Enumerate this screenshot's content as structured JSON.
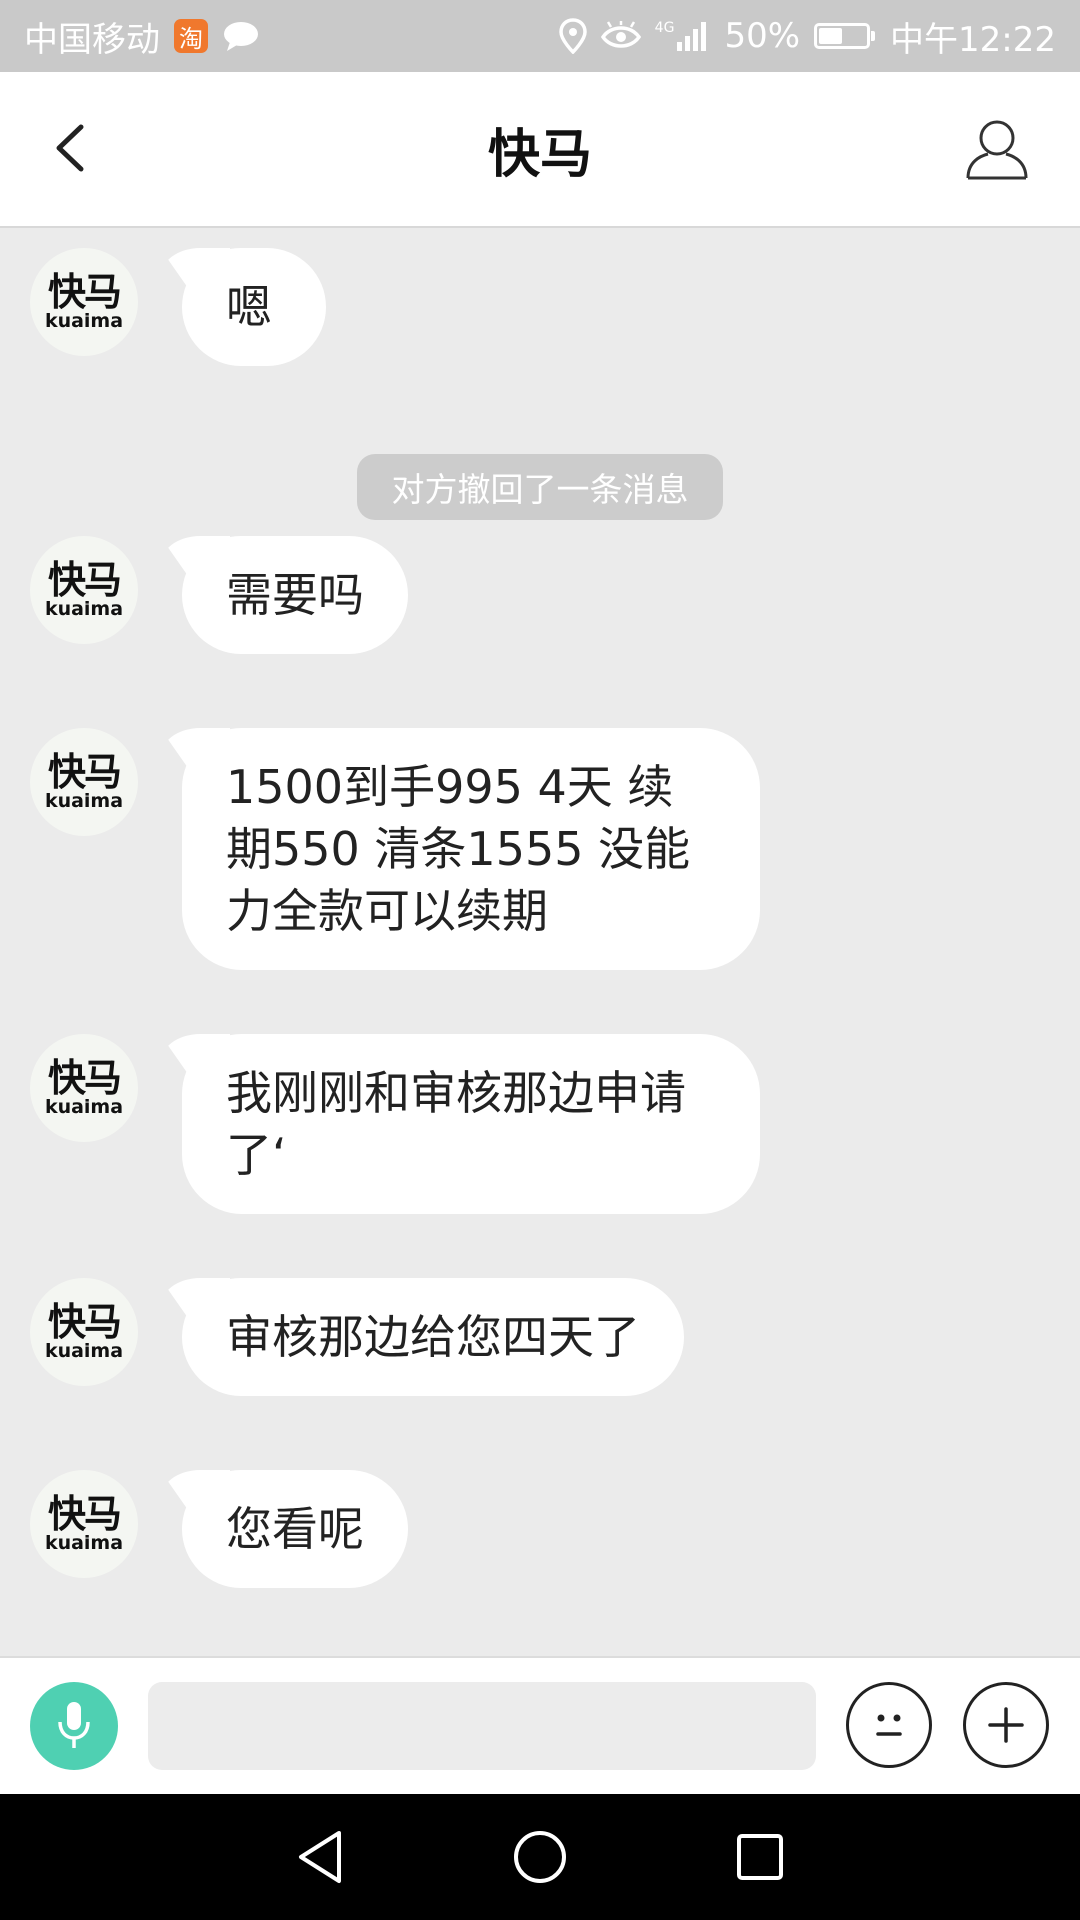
{
  "status_bar": {
    "carrier": "中国移动",
    "taobao_badge": "淘",
    "network": "4G",
    "battery": "50%",
    "battery_level": 0.5,
    "time": "中午12:22"
  },
  "header": {
    "title": "快马"
  },
  "avatar": {
    "brand_cn": "快马",
    "brand_en": "kuaima"
  },
  "messages": [
    {
      "text": "嗯"
    },
    {
      "text": "需要吗"
    },
    {
      "text": "1500到手995 4天 续期550 清条1555 没能力全款可以续期"
    },
    {
      "text": "我刚刚和审核那边申请了‘"
    },
    {
      "text": "审核那边给您四天了"
    },
    {
      "text": "您看呢"
    }
  ],
  "system_notice": "对方撤回了一条消息",
  "input": {
    "value": "",
    "placeholder": ""
  },
  "icons": {
    "back": "back-arrow-icon",
    "profile": "person-icon",
    "voice": "microphone-icon",
    "emoji": "emoji-icon",
    "plus": "plus-icon",
    "nav_back": "triangle-back-icon",
    "nav_home": "circle-home-icon",
    "nav_recent": "square-recent-icon"
  },
  "colors": {
    "voice_button": "#4fd0b2",
    "background": "#ebebeb",
    "bubble": "#ffffff"
  }
}
